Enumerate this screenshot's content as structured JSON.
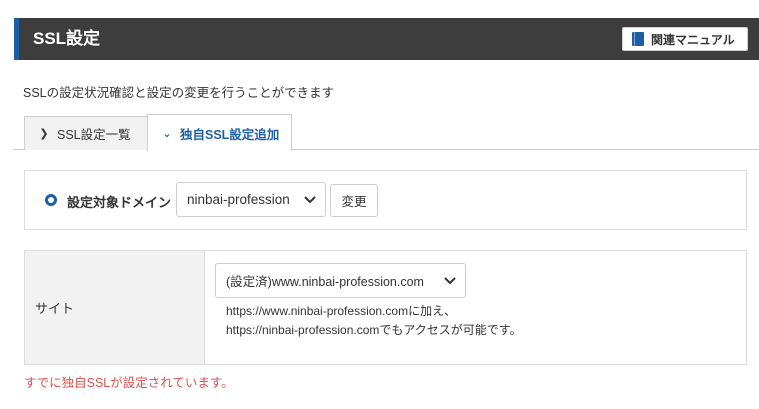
{
  "header": {
    "title": "SSL設定",
    "manual_button": "関連マニュアル",
    "manual_icon": "book-icon",
    "accent_color": "#1d5fa5",
    "bg_color": "#3d3d3d"
  },
  "description": "SSLの設定状況確認と設定の変更を行うことができます",
  "tabs": [
    {
      "label": "SSL設定一覧",
      "icon": "chevron-right-icon",
      "active": false
    },
    {
      "label": "独自SSL設定追加",
      "icon": "chevron-down-icon",
      "active": true
    }
  ],
  "domain": {
    "label": "設定対象ドメイン",
    "selected": "ninbai-profession",
    "change_button": "変更"
  },
  "site": {
    "header": "サイト",
    "selected": "(設定済)www.ninbai-profession.com",
    "note_line1": "https://www.ninbai-profession.comに加え、",
    "note_line2": "https://ninbai-profession.comでもアクセスが可能です。"
  },
  "error_message": "すでに独自SSLが設定されています。",
  "error_color": "#d9534f"
}
